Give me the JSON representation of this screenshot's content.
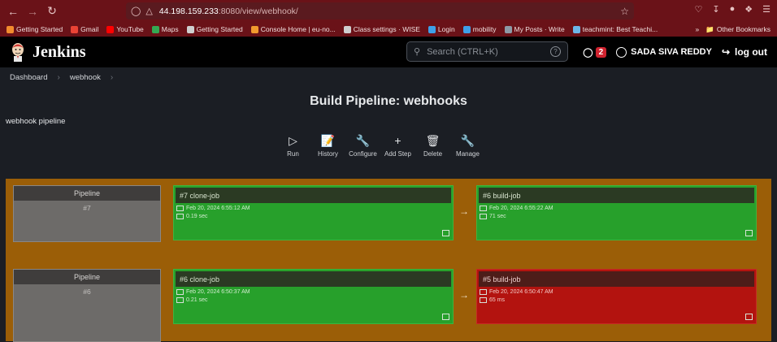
{
  "browser": {
    "url_host": "44.198.159.233",
    "url_path": ":8080/view/webhook/",
    "bookmarks": [
      {
        "label": "Getting Started",
        "color": "#f28b2e"
      },
      {
        "label": "Gmail",
        "color": "#ea4335"
      },
      {
        "label": "YouTube",
        "color": "#ff0000"
      },
      {
        "label": "Maps",
        "color": "#34a853"
      },
      {
        "label": "Getting Started",
        "color": "#cfcfcf"
      },
      {
        "label": "Console Home | eu-no...",
        "color": "#f29a2e"
      },
      {
        "label": "Class settings · WISE",
        "color": "#cfcfcf"
      },
      {
        "label": "Login",
        "color": "#3fa0e8"
      },
      {
        "label": "mobility",
        "color": "#3fa0e8"
      },
      {
        "label": "My Posts · Write",
        "color": "#8d9aa6"
      },
      {
        "label": "teachmint: Best Teachi...",
        "color": "#6db6e8"
      }
    ],
    "other_bookmarks": "Other Bookmarks"
  },
  "header": {
    "brand": "Jenkins",
    "search_placeholder": "Search (CTRL+K)",
    "security_count": "2",
    "user_name": "SADA SIVA REDDY",
    "logout_label": "log out"
  },
  "breadcrumb": [
    "Dashboard",
    "webhook"
  ],
  "page": {
    "title": "Build Pipeline: webhooks",
    "description": "webhook pipeline"
  },
  "toolbar": [
    {
      "label": "Run",
      "icon": "play-icon"
    },
    {
      "label": "History",
      "icon": "notepad-icon"
    },
    {
      "label": "Configure",
      "icon": "wrench-icon"
    },
    {
      "label": "Add Step",
      "icon": "plus-icon"
    },
    {
      "label": "Delete",
      "icon": "trash-icon"
    },
    {
      "label": "Manage",
      "icon": "wrench-icon"
    }
  ],
  "pipelines": [
    {
      "label": "Pipeline",
      "number": "#7",
      "jobs": [
        {
          "name": "#7 clone-job",
          "date": "Feb 20, 2024 6:55:12 AM",
          "duration": "0.19 sec",
          "status": "success"
        },
        {
          "name": "#6 build-job",
          "date": "Feb 20, 2024 6:55:22 AM",
          "duration": "71 sec",
          "status": "success"
        }
      ]
    },
    {
      "label": "Pipeline",
      "number": "#6",
      "jobs": [
        {
          "name": "#6 clone-job",
          "date": "Feb 20, 2024 6:50:37 AM",
          "duration": "0.21 sec",
          "status": "success"
        },
        {
          "name": "#5 build-job",
          "date": "Feb 20, 2024 6:50:47 AM",
          "duration": "65 ms",
          "status": "failed"
        }
      ]
    }
  ],
  "colors": {
    "browser_chrome": "#6a1218",
    "pipeline_bg": "#9b5e07",
    "success": "#27a02b",
    "failed": "#b3130f"
  }
}
